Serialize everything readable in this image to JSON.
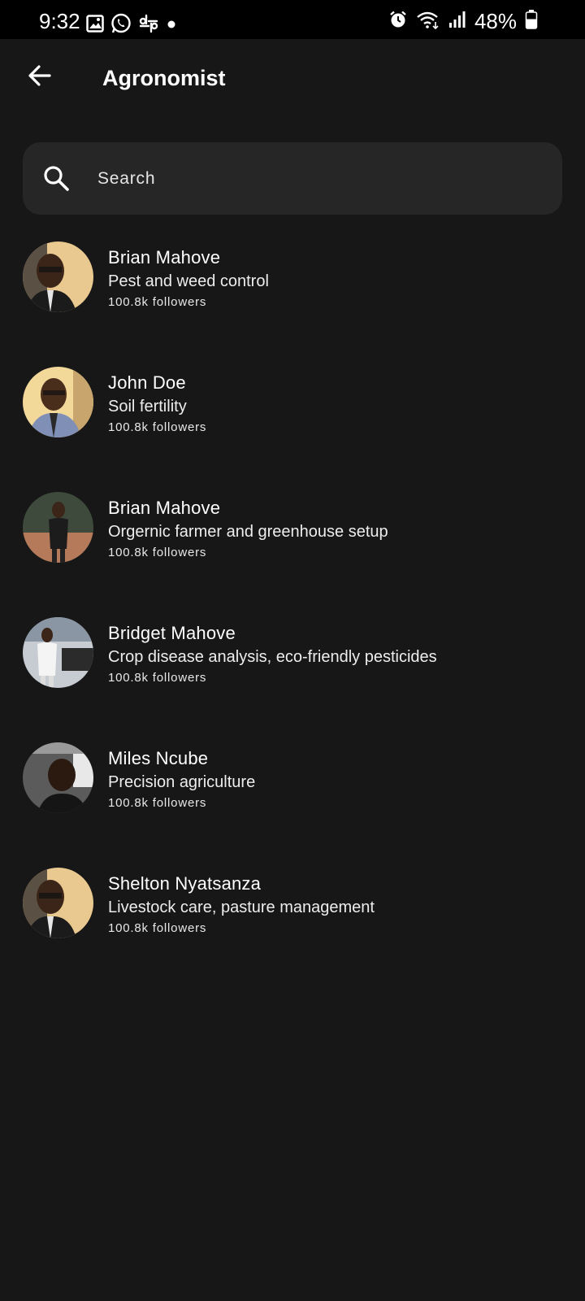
{
  "status_bar": {
    "time": "9:32",
    "battery": "48%",
    "left_icons": [
      "gallery-icon",
      "whatsapp-icon",
      "slack-icon",
      "dot-icon"
    ],
    "right_icons": [
      "alarm-icon",
      "wifi-icon",
      "signal-icon",
      "battery-icon"
    ]
  },
  "app_bar": {
    "title": "Agronomist",
    "back_icon": "arrow-left-icon"
  },
  "search": {
    "placeholder": "Search",
    "icon": "search-icon"
  },
  "experts": [
    {
      "name": "Brian Mahove",
      "specialty": "Pest and weed control",
      "followers": "100.8k followers"
    },
    {
      "name": "John Doe",
      "specialty": "Soil fertility",
      "followers": "100.8k followers"
    },
    {
      "name": "Brian Mahove",
      "specialty": "Orgernic farmer and greenhouse setup",
      "followers": "100.8k followers"
    },
    {
      "name": "Bridget Mahove",
      "specialty": "Crop disease analysis, eco-friendly pesticides",
      "followers": "100.8k followers"
    },
    {
      "name": "Miles Ncube",
      "specialty": "Precision agriculture",
      "followers": "100.8k followers"
    },
    {
      "name": "Shelton Nyatsanza",
      "specialty": "Livestock care, pasture management",
      "followers": "100.8k followers"
    }
  ],
  "colors": {
    "background": "#171717",
    "status_bar": "#000000",
    "search_background": "#262626",
    "text_primary": "#ffffff"
  }
}
